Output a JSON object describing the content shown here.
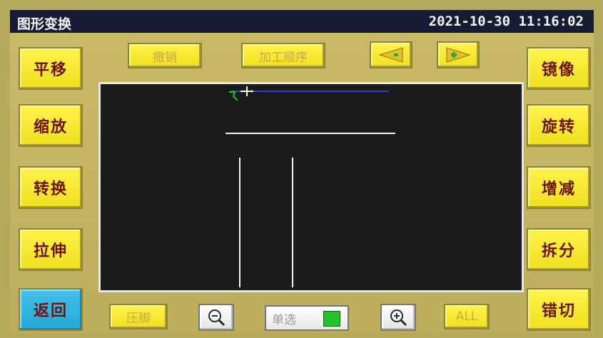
{
  "title": "图形变换",
  "datetime": "2021-10-30  11:16:02",
  "left_buttons": [
    "平移",
    "缩放",
    "转换",
    "拉伸",
    "返回"
  ],
  "right_buttons": [
    "镜像",
    "旋转",
    "增减",
    "拆分",
    "错切"
  ],
  "top": {
    "undo": "撤销",
    "process_order": "加工顺序"
  },
  "bottom": {
    "presser_foot": "压脚",
    "select_mode": "单选",
    "all": "ALL"
  },
  "colors": {
    "accent_yellow": "#f2e42a",
    "back_button": "#2bb0dc",
    "title_bar": "#161b33",
    "canvas": "#1b1b1b",
    "select_swatch": "#22c22a"
  },
  "icons": {
    "prev": "left-arrow-icon",
    "next": "right-arrow-icon",
    "zoom_out": "zoom-out-icon",
    "zoom_in": "zoom-in-icon"
  }
}
